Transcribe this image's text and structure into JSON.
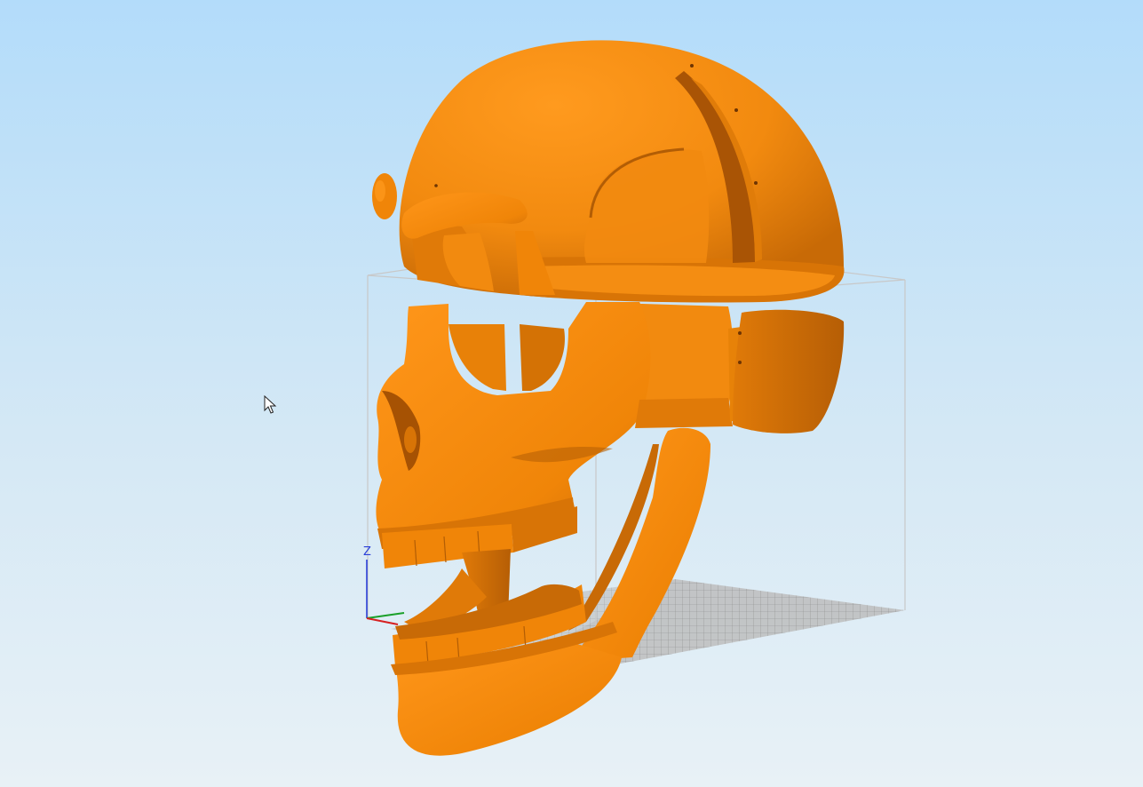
{
  "viewport": {
    "background_top": "#b3dcfa",
    "background_bottom": "#e8f1f6"
  },
  "model": {
    "color": "#f28a0f",
    "shadow_color": "#c86a06",
    "highlight_color": "#ff9a1e",
    "parts": [
      "cranium",
      "brow-ridge",
      "face",
      "cheek-plate",
      "upper-teeth",
      "lower-teeth",
      "jaw",
      "jaw-arm",
      "neck-plate"
    ]
  },
  "axes": {
    "z_label": "Z",
    "x_color": "#d62020",
    "y_color": "#1aa02a",
    "z_color": "#2a3fd9"
  },
  "build_volume": {
    "frame_color": "#c8c8c8",
    "grid_color": "#8c8c8c"
  },
  "cursor": {
    "icon": "arrow-pointer-icon"
  }
}
